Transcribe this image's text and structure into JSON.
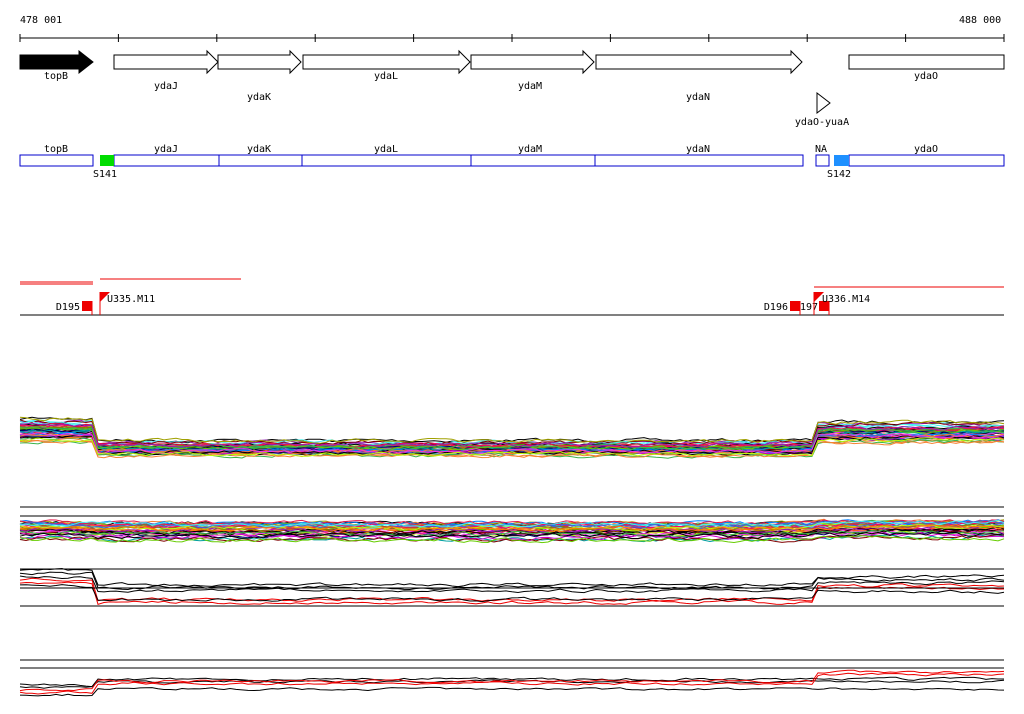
{
  "coordinates": {
    "start_label": "478 001",
    "end_label": "488 000"
  },
  "colors": {
    "region_border": "#0000cc",
    "marker_red": "#ee0000",
    "bright_black": "#000000",
    "s141": "#00dd00",
    "s142": "#1e90ff"
  },
  "genes": [
    {
      "name": "topB",
      "filled": true
    },
    {
      "name": "ydaJ",
      "filled": false
    },
    {
      "name": "ydaK",
      "filled": false
    },
    {
      "name": "ydaL",
      "filled": false
    },
    {
      "name": "ydaM",
      "filled": false
    },
    {
      "name": "ydaN",
      "filled": false
    },
    {
      "name": "ydaO",
      "filled": false
    },
    {
      "name": "ydaO-yuaA",
      "filled": false
    }
  ],
  "regions": [
    {
      "label": "topB"
    },
    {
      "label": "ydaJ"
    },
    {
      "label": "ydaK"
    },
    {
      "label": "ydaL"
    },
    {
      "label": "ydaM"
    },
    {
      "label": "ydaN"
    },
    {
      "label": "NA"
    },
    {
      "label": "ydaO"
    }
  ],
  "segments": [
    {
      "label": "S141",
      "color_key": "s141"
    },
    {
      "label": "S142",
      "color_key": "s142"
    }
  ],
  "markers": [
    {
      "label": "D195",
      "kind": "downshift"
    },
    {
      "label": "U335.M11",
      "kind": "upshift"
    },
    {
      "label": "D196",
      "kind": "downshift"
    },
    {
      "label": "197",
      "kind": "downshift"
    },
    {
      "label": "U336.M14",
      "kind": "upshift"
    }
  ],
  "tracks": [
    {
      "id": "expression-profiles"
    },
    {
      "id": "probe-profiles"
    },
    {
      "id": "condition-profiles"
    },
    {
      "id": "bottom-profiles"
    }
  ]
}
